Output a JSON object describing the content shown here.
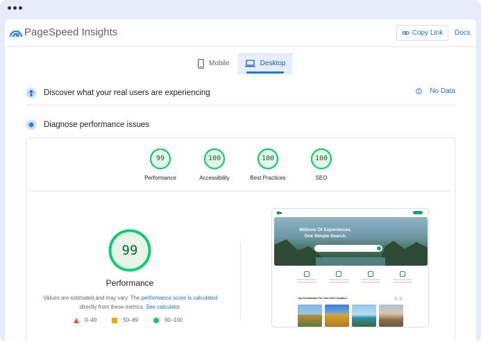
{
  "app": {
    "brand": "PageSpeed Insights",
    "copy_link": "Copy Link",
    "docs": "Docs"
  },
  "tabs": [
    {
      "label": "Mobile",
      "icon": "phone-icon",
      "active": false
    },
    {
      "label": "Desktop",
      "icon": "laptop-icon",
      "active": true
    }
  ],
  "real_users": {
    "title": "Discover what your real users are experiencing",
    "status": "No Data",
    "icon": "users-icon"
  },
  "diagnose": {
    "title": "Diagnose performance issues",
    "icon": "diagnose-icon"
  },
  "categories": [
    {
      "label": "Performance",
      "score": "99",
      "fraction": 0.99
    },
    {
      "label": "Accessibility",
      "score": "100",
      "fraction": 1.0
    },
    {
      "label": "Best Practices",
      "score": "100",
      "fraction": 1.0
    },
    {
      "label": "SEO",
      "score": "100",
      "fraction": 1.0
    }
  ],
  "performance": {
    "score": "99",
    "fraction": 0.99,
    "label": "Performance",
    "note_prefix": "Values are estimated and may vary. The ",
    "note_link1": "performance score is calculated",
    "note_mid": " directly from these metrics. ",
    "note_link2": "See calculator."
  },
  "legend": [
    {
      "range": "0–49",
      "shape": "triangle",
      "color": "#ff4e42"
    },
    {
      "range": "50–89",
      "shape": "square",
      "color": "#ffa400"
    },
    {
      "range": "90–100",
      "shape": "circle",
      "color": "#0cce6b"
    }
  ],
  "preview": {
    "hero_line1": "Millions Of Experiences.",
    "hero_line2": "One Simple Search.",
    "destinations_title": "Top Destination For Your Next Vacation"
  },
  "colors": {
    "accent": "#1a73e8",
    "pass_green": "#0cce6b",
    "pass_fill": "#e6f4ea",
    "pass_text": "#0d652d"
  }
}
